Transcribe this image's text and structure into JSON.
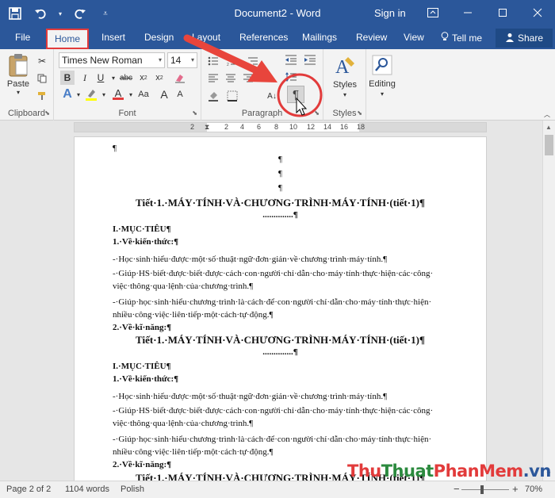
{
  "titlebar": {
    "doc_title": "Document2",
    "separator": "-",
    "app_name": "Word",
    "sign_in": "Sign in"
  },
  "tabs": {
    "file": "File",
    "home": "Home",
    "insert": "Insert",
    "design": "Design",
    "layout": "Layout",
    "references": "References",
    "mailings": "Mailings",
    "review": "Review",
    "view": "View",
    "tell_me": "Tell me",
    "share": "Share"
  },
  "ribbon": {
    "clipboard": {
      "label": "Clipboard",
      "paste": "Paste"
    },
    "font": {
      "label": "Font",
      "family": "Times New Roman",
      "size": "14"
    },
    "paragraph": {
      "label": "Paragraph",
      "pilcrow": "¶"
    },
    "styles": {
      "label": "Styles",
      "styles_btn": "Styles"
    },
    "editing": {
      "label": "Editing"
    }
  },
  "ruler": {
    "numbers": [
      "2",
      "2",
      "4",
      "6",
      "8",
      "10",
      "12",
      "14",
      "16",
      "18"
    ]
  },
  "document": {
    "pilcrow": "¶",
    "heading": "Tiết·1.·MÁY·TÍNH·VÀ·CHƯƠNG·TRÌNH·MÁY·TÍNH·(tiết·1)¶",
    "dots": "..............¶",
    "section1": "I.·MỤC·TIÊU¶",
    "knowledge": "1.·Về·kiến·thức:¶",
    "line1": "-·Học·sinh·hiểu·được·một·số·thuật·ngữ·đơn·giản·về·chương·trình·máy·tính.¶",
    "line2a": "-·Giúp·HS·biết·được·biết·được·cách·con·người·chỉ·dẫn·cho·máy·tính·thực·hiện·các·công·",
    "line2b": "việc·thông·qua·lệnh·của·chương·trình.¶",
    "line3a": "-·Giúp·học·sinh·hiểu·chương·trình·là·cách·để·con·người·chỉ·dẫn·cho·máy·tính·thực·hiện·",
    "line3b": "nhiều·công·việc·liên·tiếp·một·cách·tự·động.¶",
    "skills": "2.·Về·kĩ·năng:¶"
  },
  "status": {
    "page": "Page 2 of 2",
    "words": "1104 words",
    "language": "Polish",
    "zoom": "70%",
    "zoom_out": "−",
    "zoom_in": "+"
  },
  "watermark": {
    "part1": "Thu",
    "part2": "Thuat",
    "part3": "PhanMem",
    "part4": ".vn"
  },
  "colors": {
    "word_blue": "#2b579a",
    "highlight_red": "#e23b3b"
  }
}
